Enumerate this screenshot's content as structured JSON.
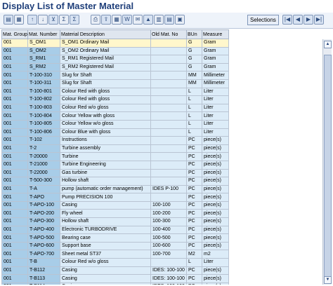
{
  "window": {
    "title": "Display List of Master Material"
  },
  "toolbar": {
    "icons": [
      "details-icon",
      "select-icon",
      "sort-ascending-icon",
      "sort-descending-icon",
      "filter-icon",
      "sum-icon",
      "subtotal-icon",
      "print-icon",
      "export-icon",
      "spreadsheet-icon",
      "word-icon",
      "mail-icon",
      "graphic-icon",
      "change-layout-icon",
      "select-layout-icon",
      "save-layout-icon"
    ],
    "selections_label": "Selections",
    "nav_icons": [
      "first-page-icon",
      "previous-page-icon",
      "next-page-icon",
      "last-page-icon"
    ]
  },
  "table": {
    "columns": [
      "Mat. Group",
      "Mat. Number",
      "Material Description",
      "Old Mat. No",
      "BUn",
      "Measure"
    ],
    "rows": [
      [
        "001",
        "S_OM1",
        "S_OM1 Ordinary Mail",
        "",
        "G",
        "Gram"
      ],
      [
        "001",
        "S_OM2",
        "S_OM2 Ordinary Mail",
        "",
        "G",
        "Gram"
      ],
      [
        "001",
        "S_RM1",
        "S_RM1 Registered Mail",
        "",
        "G",
        "Gram"
      ],
      [
        "001",
        "S_RM2",
        "S_RM2 Registered Mail",
        "",
        "G",
        "Gram"
      ],
      [
        "001",
        "T-100-310",
        "Slug for Shaft",
        "",
        "MM",
        "Millimeter"
      ],
      [
        "001",
        "T-100-311",
        "Slug for Shaft",
        "",
        "MM",
        "Millimeter"
      ],
      [
        "001",
        "T-100-801",
        "Colour Red with gloss",
        "",
        "L",
        "Liter"
      ],
      [
        "001",
        "T-100-802",
        "Colour Red with gloss",
        "",
        "L",
        "Liter"
      ],
      [
        "001",
        "T-100-803",
        "Colour Red w/o gloss",
        "",
        "L",
        "Liter"
      ],
      [
        "001",
        "T-100-804",
        "Colour Yellow with gloss",
        "",
        "L",
        "Liter"
      ],
      [
        "001",
        "T-100-805",
        "Colour Yellow w/o gloss",
        "",
        "L",
        "Liter"
      ],
      [
        "001",
        "T-100-806",
        "Colour Blue with gloss",
        "",
        "L",
        "Liter"
      ],
      [
        "001",
        "T-102",
        "Instructions",
        "",
        "PC",
        "piece(s)"
      ],
      [
        "001",
        "T-2",
        "Turbine assembly",
        "",
        "PC",
        "piece(s)"
      ],
      [
        "001",
        "T-20000",
        "Turbine",
        "",
        "PC",
        "piece(s)"
      ],
      [
        "001",
        "T-21000",
        "Turbine Engineering",
        "",
        "PC",
        "piece(s)"
      ],
      [
        "001",
        "T-22000",
        "Gas turbine",
        "",
        "PC",
        "piece(s)"
      ],
      [
        "001",
        "T-500-300",
        "Hollow shaft",
        "",
        "PC",
        "piece(s)"
      ],
      [
        "001",
        "T-A",
        "pump  (automatic order management)",
        "IDES P-100",
        "PC",
        "piece(s)"
      ],
      [
        "001",
        "T-APO",
        "Pump PRECISION 100",
        "",
        "PC",
        "piece(s)"
      ],
      [
        "001",
        "T-APO-100",
        "Casing",
        "100-100",
        "PC",
        "piece(s)"
      ],
      [
        "001",
        "T-APO-200",
        "Fly wheel",
        "100-200",
        "PC",
        "piece(s)"
      ],
      [
        "001",
        "T-APO-300",
        "Hollow shaft",
        "100-300",
        "PC",
        "piece(s)"
      ],
      [
        "001",
        "T-APO-400",
        "Electronic  TURBODRIVE",
        "100-400",
        "PC",
        "piece(s)"
      ],
      [
        "001",
        "T-APO-500",
        "Bearing case",
        "100-500",
        "PC",
        "piece(s)"
      ],
      [
        "001",
        "T-APO-600",
        "Support base",
        "100-600",
        "PC",
        "piece(s)"
      ],
      [
        "001",
        "T-APO-700",
        "Sheet metal ST37",
        "100-700",
        "M2",
        "m2"
      ],
      [
        "001",
        "T-B",
        "Colour Red w/o gloss",
        "",
        "L",
        "Liter"
      ],
      [
        "001",
        "T-B112",
        "Casing",
        "IDES: 100-100",
        "PC",
        "piece(s)"
      ],
      [
        "001",
        "T-B113",
        "Casing",
        "IDES: 100-100",
        "PC",
        "piece(s)"
      ],
      [
        "001",
        "T-B114",
        "Casing",
        "IDES: 100-100",
        "PC",
        "piece(s)"
      ]
    ]
  },
  "scrollbar": {
    "up_icon": "scroll-up-icon",
    "down_icon": "scroll-down-icon"
  }
}
